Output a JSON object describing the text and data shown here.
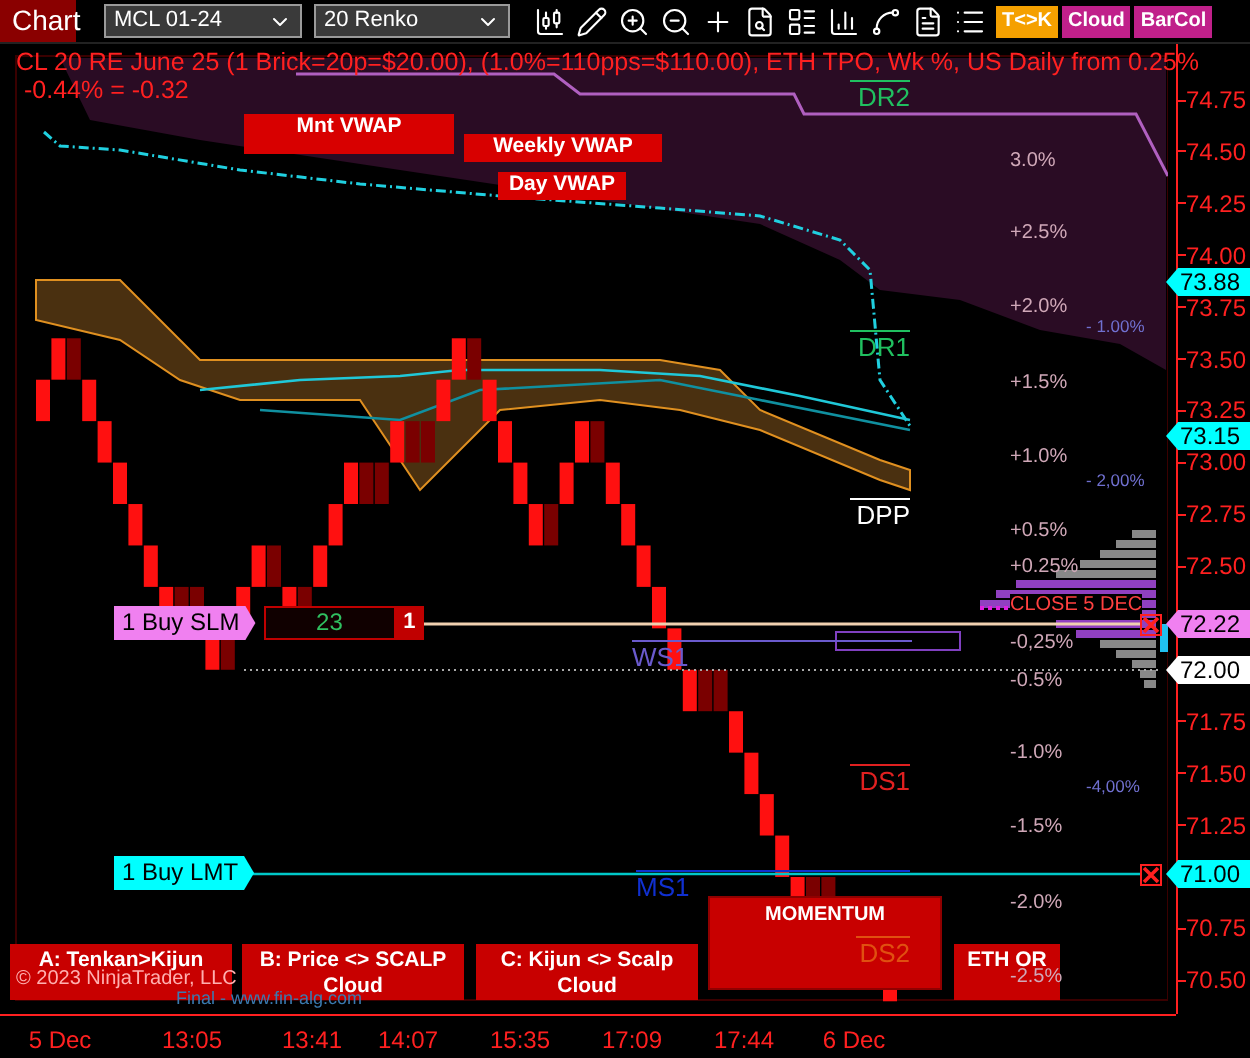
{
  "toolbar": {
    "title": "Chart",
    "instrument": "MCL 01-24",
    "bar_type": "20 Renko",
    "toggles": [
      {
        "label": "T<>K",
        "color": "#f5a000"
      },
      {
        "label": "Cloud",
        "color": "#c0208a"
      },
      {
        "label": "BarCol",
        "color": "#c0208a"
      }
    ]
  },
  "chart": {
    "header": "CL 20 RE June 25 (1 Brick=20p=$20.00), (1.0%=110pps=$110.00), ETH TPO, Wk %, US Daily from 0.25%",
    "change": "-0.44% = -0.32",
    "vwap_labels": [
      "Mnt VWAP",
      "Weekly VWAP",
      "Day VWAP"
    ],
    "pivots": [
      {
        "label": "DR2",
        "color": "#20c060"
      },
      {
        "label": "DR1",
        "color": "#20c060"
      },
      {
        "label": "DPP",
        "color": "#ffffff"
      },
      {
        "label": "WS1",
        "color": "#6a5acd"
      },
      {
        "label": "DS1",
        "color": "#e02020"
      },
      {
        "label": "MS1",
        "color": "#1030d0"
      },
      {
        "label": "DS2",
        "color": "#e05010"
      }
    ],
    "percent_levels": [
      "3.0%",
      "+2.5%",
      "+2.0%",
      "+1.5%",
      "+1.0%",
      "+0.5%",
      "+0.25%",
      "-0,25%",
      "-0.5%",
      "-1.0%",
      "-1.5%",
      "-2.0%",
      "-2.5%"
    ],
    "weekly_levels": [
      "- 1.00%",
      "- 2,00%",
      "-4,00%"
    ],
    "close_label": "CLOSE 5 DEC",
    "orders": [
      {
        "label": "1 Buy SLM",
        "color": "#f080f0",
        "quantity": "23",
        "count": "1"
      },
      {
        "label": "1 Buy LMT",
        "color": "#00ffff"
      }
    ],
    "signals": [
      "A: Tenkan>Kijun",
      "B: Price <> SCALP Cloud",
      "C: Kijun <> Scalp Cloud",
      "MOMENTUM",
      "ETH OR"
    ],
    "copyright": "© 2023 NinjaTrader, LLC",
    "credit": "Final - www.fin-alg.com"
  },
  "price_axis": {
    "ticks": [
      "74.75",
      "74.50",
      "74.25",
      "74.00",
      "73.75",
      "73.50",
      "73.25",
      "73.00",
      "72.75",
      "72.50",
      "71.75",
      "71.50",
      "71.25",
      "70.75",
      "70.50"
    ],
    "markers": [
      {
        "label": "73.88",
        "color": "#00ffff"
      },
      {
        "label": "73.15",
        "color": "#00ffff"
      },
      {
        "label": "72.22",
        "color": "#f080f0"
      },
      {
        "label": "72.00",
        "color": "#ffffff"
      },
      {
        "label": "71.00",
        "color": "#00ffff"
      }
    ]
  },
  "time_axis": {
    "labels": [
      "5 Dec",
      "13:05",
      "13:41",
      "14:07",
      "15:35",
      "17:09",
      "17:44",
      "6 Dec"
    ]
  }
}
